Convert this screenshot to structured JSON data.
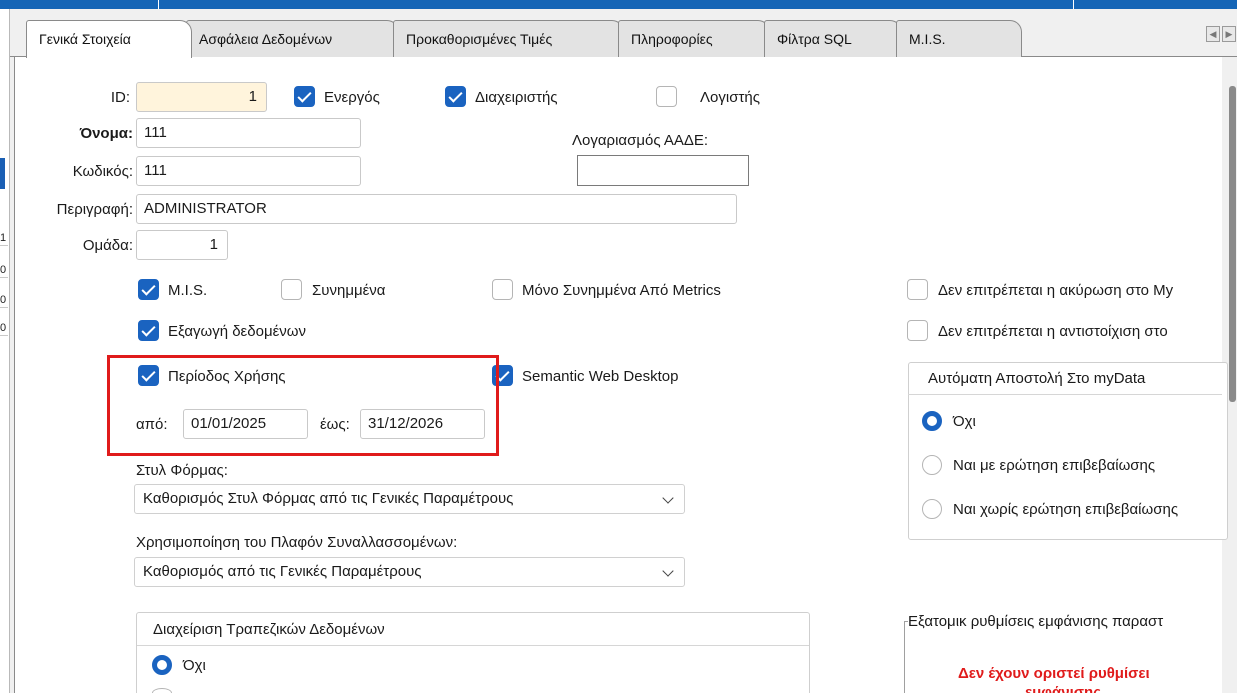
{
  "tabs": [
    {
      "label": "Γενικά Στοιχεία",
      "active": true
    },
    {
      "label": "Ασφάλεια Δεδομένων",
      "active": false
    },
    {
      "label": "Προκαθορισμένες Τιμές",
      "active": false
    },
    {
      "label": "Πληροφορίες",
      "active": false
    },
    {
      "label": "Φίλτρα SQL",
      "active": false
    },
    {
      "label": "M.I.S.",
      "active": false
    }
  ],
  "left_strip": {
    "cells": [
      "1",
      "0",
      "0",
      "0"
    ]
  },
  "form": {
    "id_label": "ID:",
    "id_value": "1",
    "active_label": "Ενεργός",
    "active_checked": true,
    "admin_label": "Διαχειριστής",
    "admin_checked": true,
    "accountant_label": "Λογιστής",
    "accountant_checked": false,
    "name_label": "Όνομα:",
    "name_value": "111",
    "aade_label": "Λογαριασμός ΑΑΔΕ:",
    "aade_value": "",
    "code_label": "Κωδικός:",
    "code_value": "111",
    "description_label": "Περιγραφή:",
    "description_value": "ADMINISTRATOR",
    "group_label": "Ομάδα:",
    "group_value": "1"
  },
  "options": {
    "mis_label": "M.I.S.",
    "mis_checked": true,
    "attachments_label": "Συνημμένα",
    "attachments_checked": false,
    "metrics_only_label": "Μόνο Συνημμένα Από Metrics",
    "metrics_only_checked": false,
    "no_cancel_label": "Δεν επιτρέπεται η ακύρωση στο My",
    "no_cancel_checked": false,
    "export_label": "Εξαγωγή δεδομένων",
    "export_checked": true,
    "no_match_label": "Δεν επιτρέπεται η αντιστοίχιση στο",
    "no_match_checked": false,
    "usage_period_label": "Περίοδος Χρήσης",
    "usage_period_checked": true,
    "semantic_label": "Semantic Web Desktop",
    "semantic_checked": true,
    "from_label": "από:",
    "from_value": "01/01/2025",
    "to_label": "έως:",
    "to_value": "31/12/2026"
  },
  "mydata": {
    "title": "Αυτόματη Αποστολή Στο myData",
    "options": [
      {
        "label": "Όχι",
        "selected": true
      },
      {
        "label": "Ναι με ερώτηση επιβεβαίωσης",
        "selected": false
      },
      {
        "label": "Ναι χωρίς ερώτηση επιβεβαίωσης",
        "selected": false
      }
    ]
  },
  "form_style": {
    "label": "Στυλ Φόρμας:",
    "value": "Καθορισμός Στυλ Φόρμας από τις Γενικές Παραμέτρους"
  },
  "credit_limit": {
    "label": "Χρησιμοποίηση του Πλαφόν Συναλλασσομένων:",
    "value": "Καθορισμός από τις Γενικές Παραμέτρους"
  },
  "bank": {
    "title": "Διαχείριση Τραπεζικών Δεδομένων",
    "option_no": "Όχι"
  },
  "display": {
    "title": "Εξατομικ ρυθμίσεις εμφάνισης παραστ",
    "warning": "Δεν έχουν οριστεί ρυθμίσει",
    "warning_line2": "εμφάνισης"
  },
  "colors": {
    "accent": "#1a63c0",
    "topbar": "#1565b6",
    "highlight": "#e01b1b"
  }
}
